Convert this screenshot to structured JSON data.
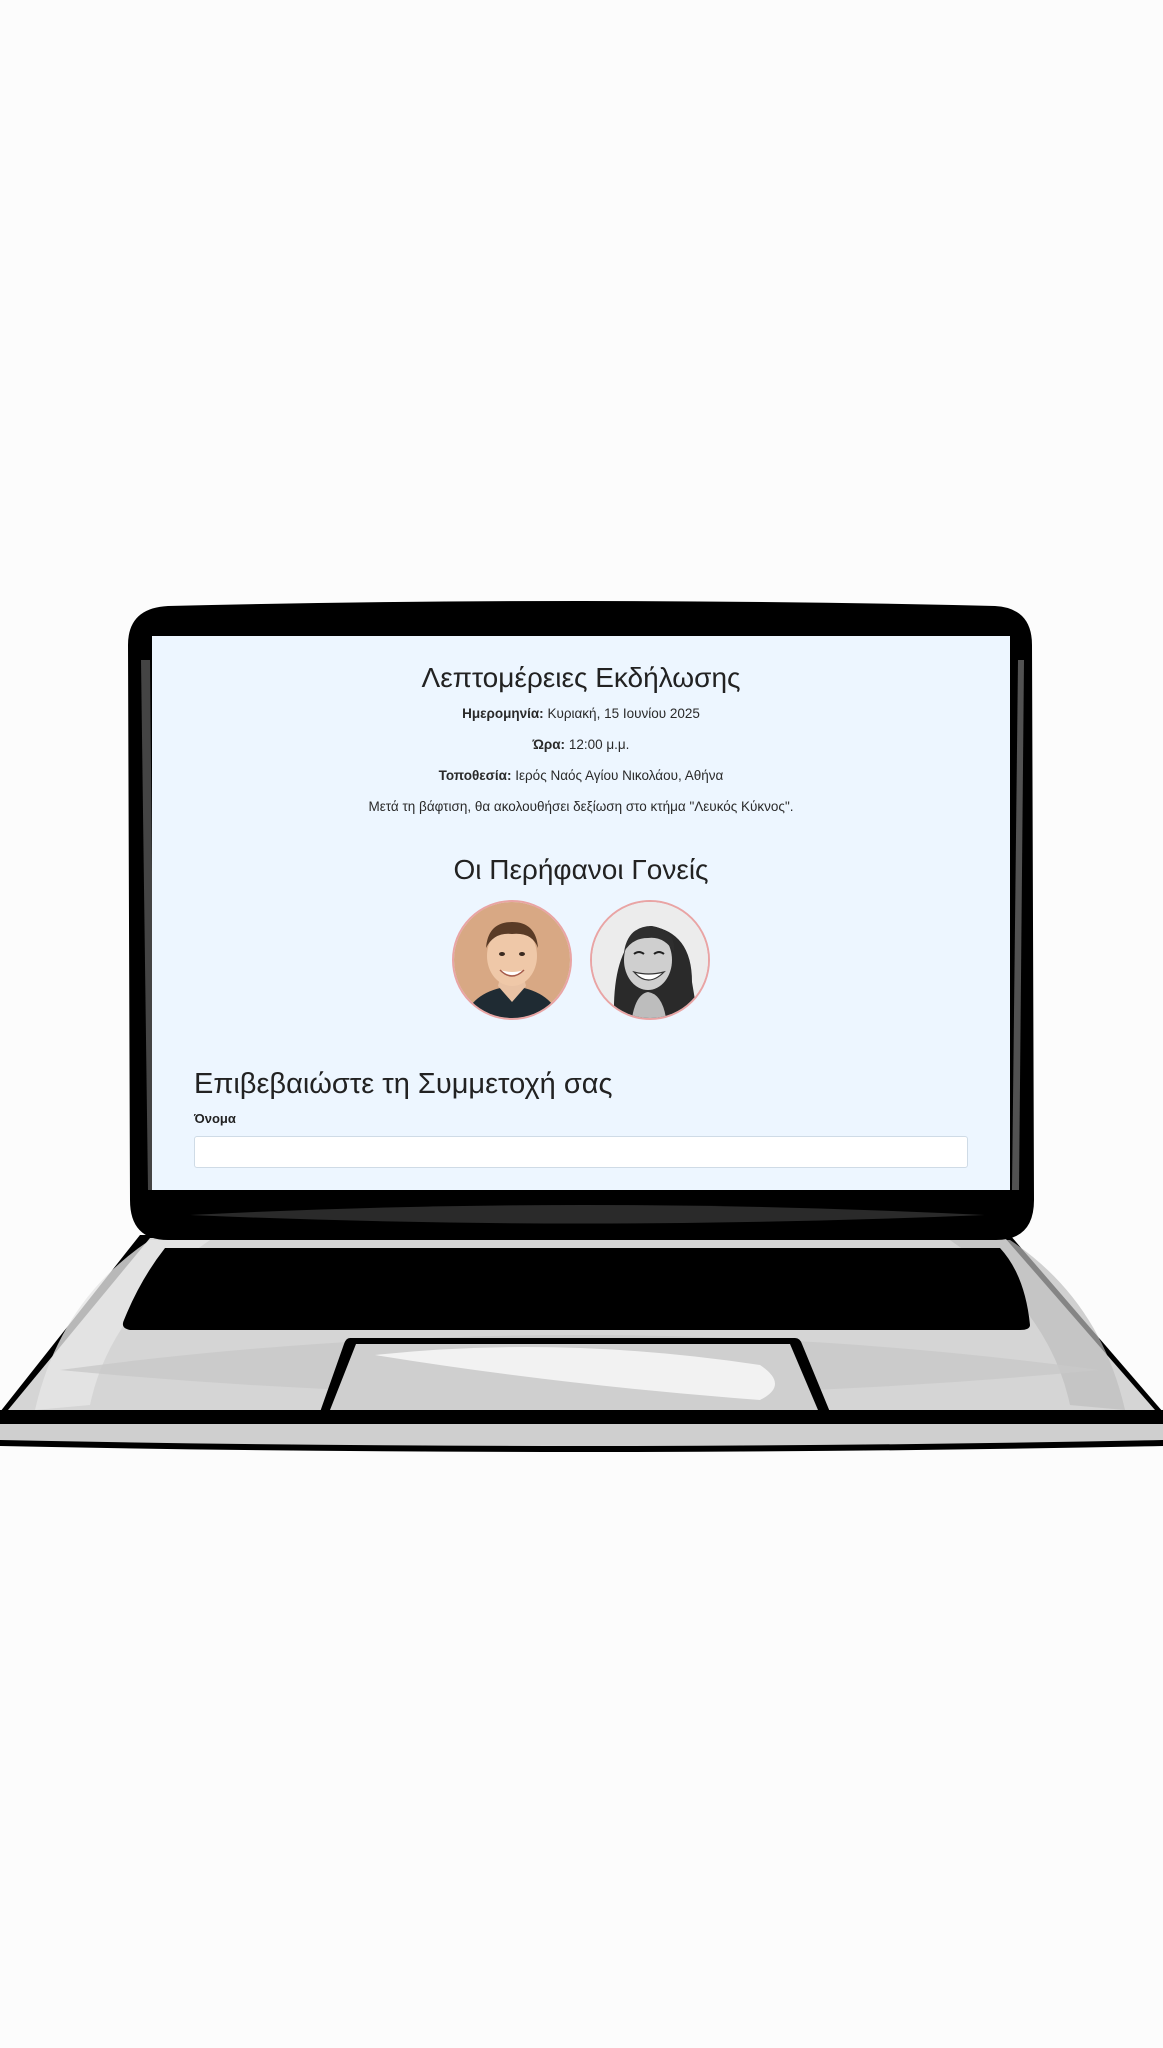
{
  "event_details": {
    "heading": "Λεπτομέρειες Εκδήλωσης",
    "date_label": "Ημερομηνία:",
    "date_value": "Κυριακή, 15 Ιουνίου 2025",
    "time_label": "Ώρα:",
    "time_value": "12:00 μ.μ.",
    "location_label": "Τοποθεσία:",
    "location_value": "Ιερός Ναός Αγίου Νικολάου, Αθήνα",
    "note": "Μετά τη βάφτιση, θα ακολουθήσει δεξίωση στο κτήμα \"Λευκός Κύκνος\"."
  },
  "parents": {
    "heading": "Οι Περήφανοι Γονείς"
  },
  "rsvp": {
    "heading": "Επιβεβαιώστε τη Συμμετοχή σας",
    "name_label": "Όνομα",
    "name_value": ""
  },
  "colors": {
    "screen_background": "#edf6ff",
    "avatar_border": "#e9a4a4",
    "laptop_frame": "#000000",
    "laptop_body": "#d4d4d4"
  }
}
